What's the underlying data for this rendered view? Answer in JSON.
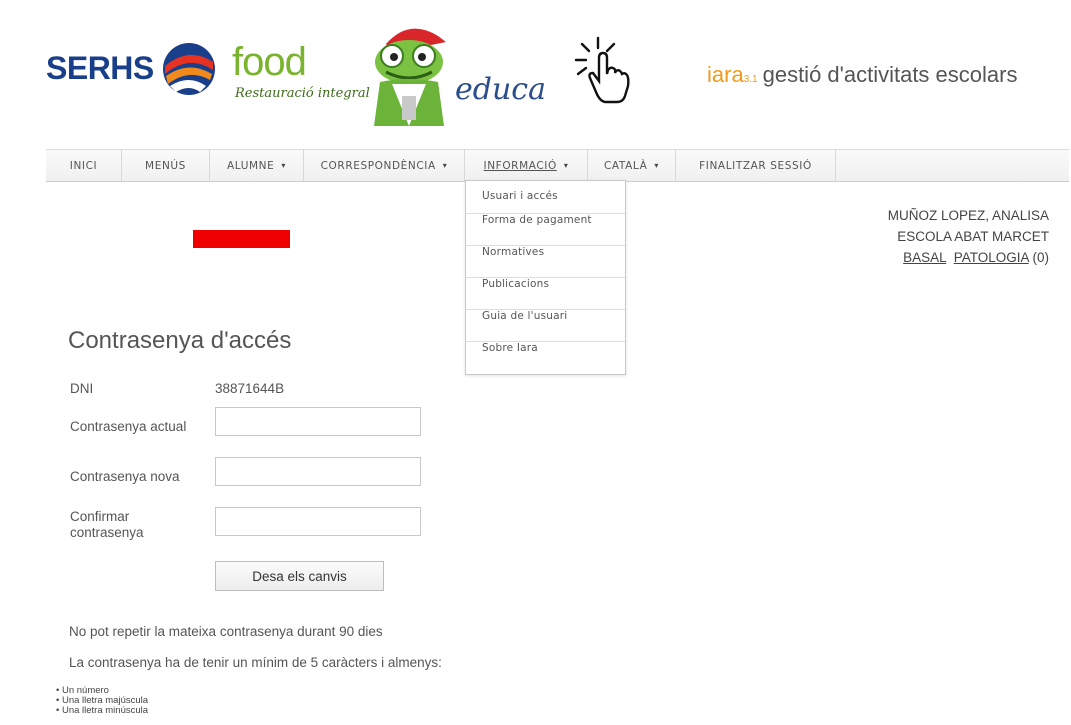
{
  "header": {
    "brand1": "SERHS",
    "brand2": "food",
    "brand2_sub": "Restauració integral",
    "brand3": "educa",
    "app_name": "iara",
    "app_version": "3.1",
    "app_tagline": "gestió d'activitats escolars",
    "colors": {
      "serhs_blue": "#1a3f8a",
      "food_green": "#7ab32e",
      "iara_orange": "#f29a1a"
    }
  },
  "nav": {
    "items": [
      {
        "label": "INICI"
      },
      {
        "label": "MENÚS"
      },
      {
        "label": "ALUMNE",
        "caret": "▾"
      },
      {
        "label": "CORRESPONDÈNCIA",
        "caret": "▾"
      },
      {
        "label": "INFORMACIÓ",
        "caret": "▾"
      },
      {
        "label": "CATALÀ",
        "caret": "▾"
      },
      {
        "label": "FINALITZAR SESSIÓ"
      }
    ]
  },
  "dropdown": {
    "items": [
      "Usuari i accés",
      "Forma de pagament",
      "Normatives",
      "Publicacions",
      "Guia de l'usuari",
      "Sobre Iara"
    ]
  },
  "user": {
    "name": "MUÑOZ LOPEZ, ANALISA",
    "school": "ESCOLA ABAT MARCET",
    "link1": "BASAL",
    "link2": "PATOLOGIA",
    "link2_count": "(0)"
  },
  "form": {
    "title": "Contrasenya d'accés",
    "dni_label": "DNI",
    "dni_value": "38871644B",
    "current_label": "Contrasenya actual",
    "new_label": "Contrasenya nova",
    "confirm_label_line1": "Confirmar",
    "confirm_label_line2": "contrasenya",
    "current_value": "",
    "new_value": "",
    "confirm_value": "",
    "save_label": "Desa els canvis"
  },
  "notes": {
    "repeat": "No pot repetir la mateixa contrasenya durant 90 dies",
    "rule_intro": "La contrasenya ha de tenir un mínim de 5 caràcters i almenys:",
    "rules": [
      "Un número",
      "Una lletra majúscula",
      "Una lletra minúscula"
    ]
  }
}
